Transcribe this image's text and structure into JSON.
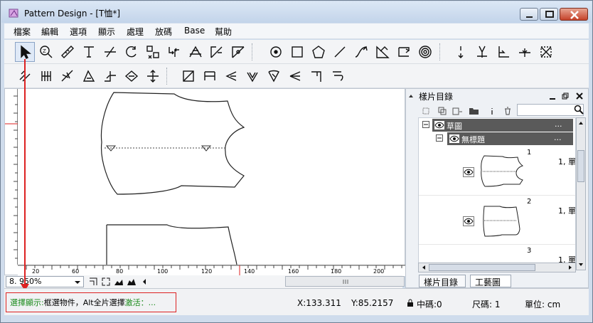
{
  "window": {
    "title": "Pattern Design - [T恤*]"
  },
  "menu": [
    "檔案",
    "編輯",
    "選項",
    "顯示",
    "處理",
    "放碼",
    "Base",
    "幫助"
  ],
  "toolbar": {
    "row1_icons": [
      "select-arrow-icon",
      "zoom-icon",
      "measure-ruler-icon",
      "text-icon",
      "cut-line-icon",
      "rotate-icon",
      "mirror-icon",
      "swap-icon",
      "adjust-point-icon",
      "adjust-curve-icon",
      "add-point-icon",
      "circle-point-icon",
      "rectangle-icon",
      "polygon-icon",
      "line-icon",
      "curve-icon",
      "edit-curve-icon",
      "connect-icon",
      "spiral-icon",
      "notch-icon",
      "notch-cut-icon",
      "axis-icon",
      "dart-icon",
      "grid-mark-icon"
    ],
    "row2_icons": [
      "cut-tool-icon",
      "pleat-icon",
      "fold-icon",
      "angle-icon",
      "split-icon",
      "diamond-icon",
      "move-icon",
      "grading-box-icon",
      "width-tool-icon",
      "point-left-icon",
      "petal-icon",
      "flower-icon",
      "fan-icon",
      "corner-icon",
      "hook-icon"
    ]
  },
  "zoom": {
    "value": "8. 950%"
  },
  "ruler": {
    "labels": [
      "20",
      "60",
      "80",
      "100",
      "120",
      "140",
      "160",
      "180",
      "200"
    ]
  },
  "panel": {
    "title": "樣片目錄",
    "tree": {
      "group": "草圖",
      "group_ellipsis": "...",
      "child": "無標題",
      "child_ellipsis": "..."
    },
    "pieces": [
      {
        "num": "1",
        "info": "1, 單"
      },
      {
        "num": "2",
        "info": "1, 單"
      },
      {
        "num": "3",
        "info": "1, 單"
      }
    ],
    "tabs": [
      "樣片目錄",
      "工藝圖"
    ]
  },
  "status": {
    "hint_green": "選擇顯示:",
    "hint_black": "框選物件，Alt全片選擇",
    "hint_green2": "激活：...",
    "x": "X:133.311",
    "y": "Y:85.2157",
    "medium": "中碼:0",
    "size": "尺碼: 1",
    "unit": "單位: cm"
  }
}
